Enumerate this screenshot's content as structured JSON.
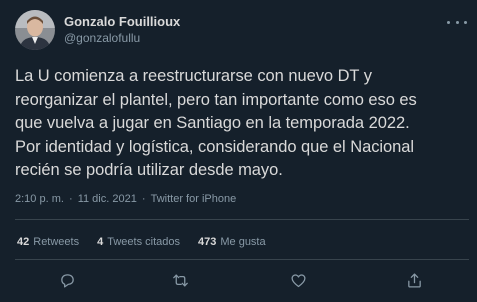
{
  "user": {
    "display_name": "Gonzalo Fouillioux",
    "handle": "@gonzalofullu"
  },
  "tweet": {
    "text": "La U comienza a reestructurarse con nuevo DT y\nreorganizar el plantel, pero tan importante como eso es\nque vuelva a jugar en Santiago en la temporada 2022.\nPor identidad y logística, considerando que el Nacional\nrecién se podría utilizar desde mayo.",
    "time": "2:10 p. m.",
    "date": "11 dic. 2021",
    "source": "Twitter for iPhone"
  },
  "stats": {
    "retweets_count": "42",
    "retweets_label": "Retweets",
    "quotes_count": "4",
    "quotes_label": "Tweets citados",
    "likes_count": "473",
    "likes_label": "Me gusta"
  },
  "icons": {
    "more": "more-icon",
    "reply": "reply-icon",
    "retweet": "retweet-icon",
    "like": "heart-icon",
    "share": "share-icon"
  },
  "colors": {
    "background": "#15202b",
    "text": "#d9d9d9",
    "secondary": "#8899a6",
    "divider": "#38444d"
  }
}
